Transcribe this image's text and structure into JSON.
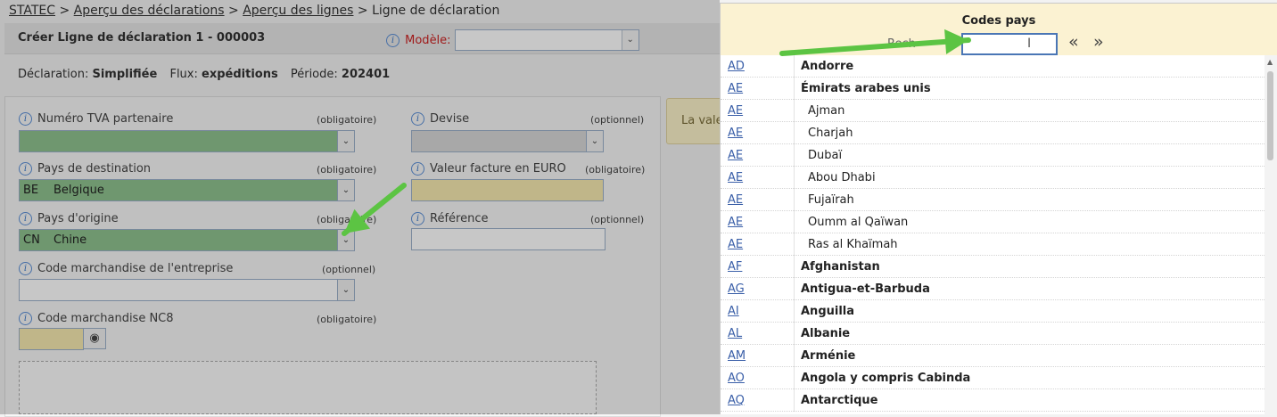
{
  "breadcrumb": {
    "items": [
      "STATEC",
      "Aperçu des déclarations",
      "Aperçu des lignes"
    ],
    "separator": ">",
    "current": "Ligne de déclaration"
  },
  "header": {
    "title": "Créer Ligne de déclaration 1 - 000003",
    "modele_label": "Modèle:",
    "modele_value": ""
  },
  "declaration": {
    "type_label": "Déclaration:",
    "type_value": "Simplifiée",
    "flux_label": "Flux:",
    "flux_value": "expéditions",
    "periode_label": "Période:",
    "periode_value": "202401"
  },
  "form": {
    "tva": {
      "label": "Numéro TVA partenaire",
      "hint": "(obligatoire)"
    },
    "devise": {
      "label": "Devise",
      "hint": "(optionnel)"
    },
    "pays_destination": {
      "label": "Pays de destination",
      "hint": "(obligatoire)",
      "code": "BE",
      "name": "Belgique"
    },
    "valeur": {
      "label": "Valeur facture en EURO",
      "hint": "(obligatoire)",
      "value": ""
    },
    "pays_origine": {
      "label": "Pays d'origine",
      "hint": "(obligatoire)",
      "code": "CN",
      "name": "Chine"
    },
    "reference": {
      "label": "Référence",
      "hint": "(optionnel)",
      "value": ""
    },
    "code_entreprise": {
      "label": "Code marchandise de l'entreprise",
      "hint": "(optionnel)"
    },
    "code_nc8": {
      "label": "Code marchandise NC8",
      "hint": "(obligatoire)"
    }
  },
  "note_text": "La vale",
  "popup": {
    "title": "Codes pays",
    "search_label": "Rech",
    "search_value": "",
    "prev_label": "«",
    "next_label": "»",
    "rows": [
      {
        "code": "AD",
        "name": "Andorre",
        "level": "main"
      },
      {
        "code": "AE",
        "name": "Émirats arabes unis",
        "level": "main"
      },
      {
        "code": "AE",
        "name": "Ajman",
        "level": "sub"
      },
      {
        "code": "AE",
        "name": "Charjah",
        "level": "sub"
      },
      {
        "code": "AE",
        "name": "Dubaï",
        "level": "sub"
      },
      {
        "code": "AE",
        "name": "Abou Dhabi",
        "level": "sub"
      },
      {
        "code": "AE",
        "name": "Fujaïrah",
        "level": "sub"
      },
      {
        "code": "AE",
        "name": "Oumm al Qaïwan",
        "level": "sub"
      },
      {
        "code": "AE",
        "name": "Ras al Khaïmah",
        "level": "sub"
      },
      {
        "code": "AF",
        "name": "Afghanistan",
        "level": "main"
      },
      {
        "code": "AG",
        "name": "Antigua-et-Barbuda",
        "level": "main"
      },
      {
        "code": "AI",
        "name": "Anguilla",
        "level": "main"
      },
      {
        "code": "AL",
        "name": "Albanie",
        "level": "main"
      },
      {
        "code": "AM",
        "name": "Arménie",
        "level": "main"
      },
      {
        "code": "AO",
        "name": "Angola y compris Cabinda",
        "level": "main"
      },
      {
        "code": "AQ",
        "name": "Antarctique",
        "level": "main"
      }
    ]
  },
  "icons": {
    "info": "info-icon",
    "dropdown": "chevron-down-icon",
    "eye": "eye-icon",
    "annotation_arrow_color": "#5cc443"
  }
}
